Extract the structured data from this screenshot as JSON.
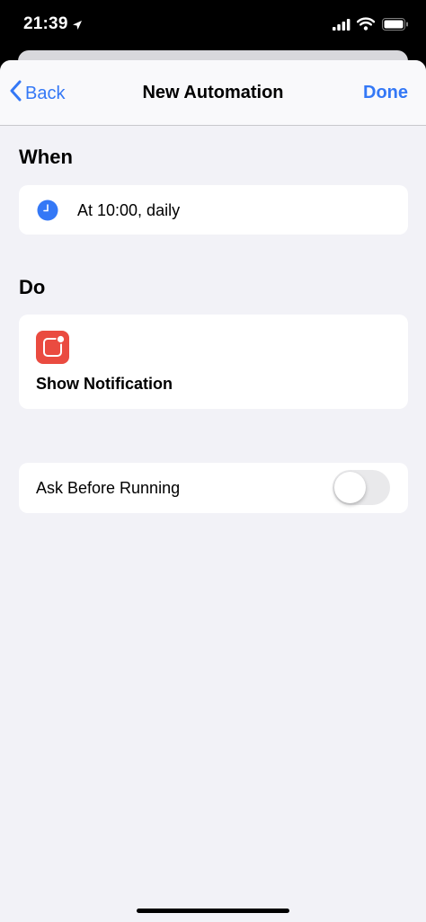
{
  "status_bar": {
    "time": "21:39"
  },
  "nav": {
    "back_label": "Back",
    "title": "New Automation",
    "done_label": "Done"
  },
  "when": {
    "heading": "When",
    "trigger_text": "At 10:00, daily"
  },
  "do": {
    "heading": "Do",
    "action_label": "Show Notification"
  },
  "ask_before_running": {
    "label": "Ask Before Running",
    "enabled": false
  },
  "colors": {
    "accent": "#3478f6",
    "background": "#f2f2f7",
    "notification_icon": "#ea4b40",
    "toggle_off": "#e9e9eb"
  },
  "icons": [
    "location-arrow-icon",
    "signal-icon",
    "wifi-icon",
    "battery-icon",
    "chevron-left-icon",
    "clock-icon",
    "notification-icon"
  ]
}
